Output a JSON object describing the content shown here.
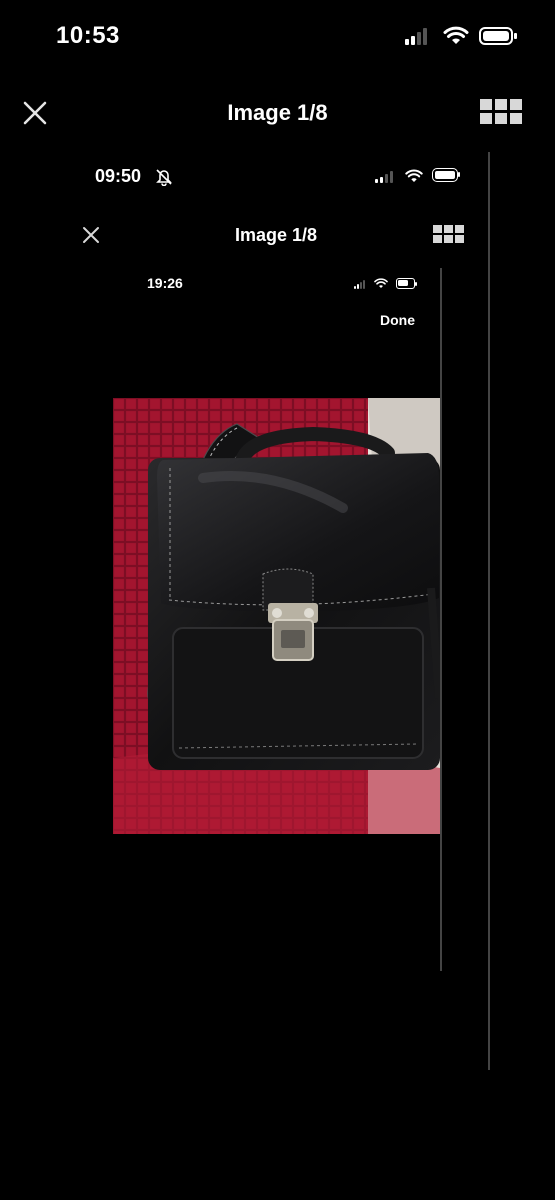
{
  "outer": {
    "status_time": "10:53",
    "title": "Image 1/8"
  },
  "middle": {
    "status_time": "09:50",
    "title": "Image 1/8"
  },
  "inner": {
    "status_time": "19:26",
    "done_label": "Done"
  },
  "photo": {
    "subject": "black-leather-crossbody-bag"
  },
  "colors": {
    "background": "#000000",
    "text": "#ffffff",
    "photo_backdrop": "#9e1530"
  },
  "icons": {
    "close": "close-icon",
    "grid": "grid-view-icon",
    "signal": "cellular-signal-icon",
    "wifi": "wifi-icon",
    "battery": "battery-icon",
    "bell_muted": "bell-slash-icon"
  }
}
